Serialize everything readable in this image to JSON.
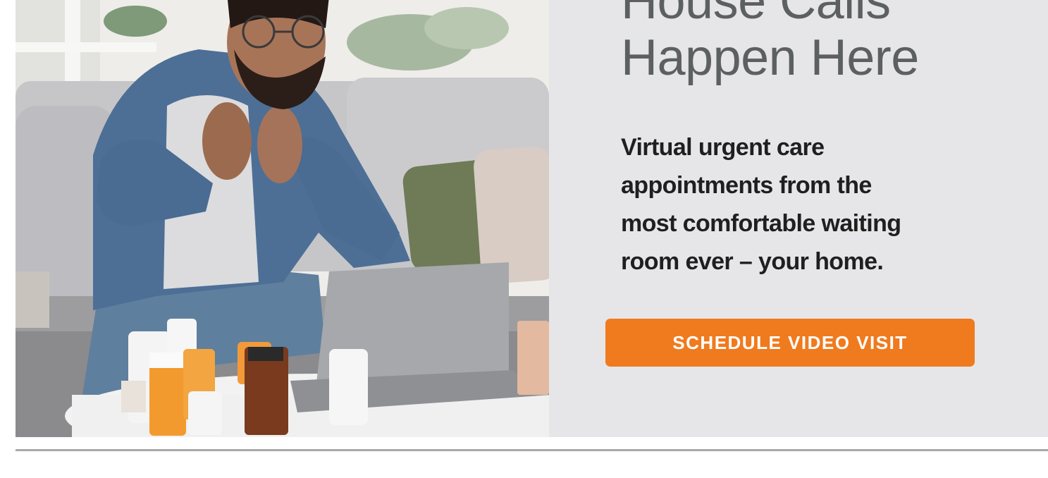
{
  "banner": {
    "headline_lines": [
      "House Calls",
      "Happen Here"
    ],
    "subcopy_lines": [
      "Virtual urgent care",
      "appointments from the",
      "most comfortable waiting",
      "room ever – your home."
    ],
    "cta_label": "SCHEDULE VIDEO VISIT"
  },
  "colors": {
    "panel_background": "#e6e6e8",
    "headline": "#5d6062",
    "subcopy": "#1f1f1f",
    "cta_background": "#f07a1e",
    "cta_text": "#ffffff",
    "divider": "#a8a9ab"
  }
}
